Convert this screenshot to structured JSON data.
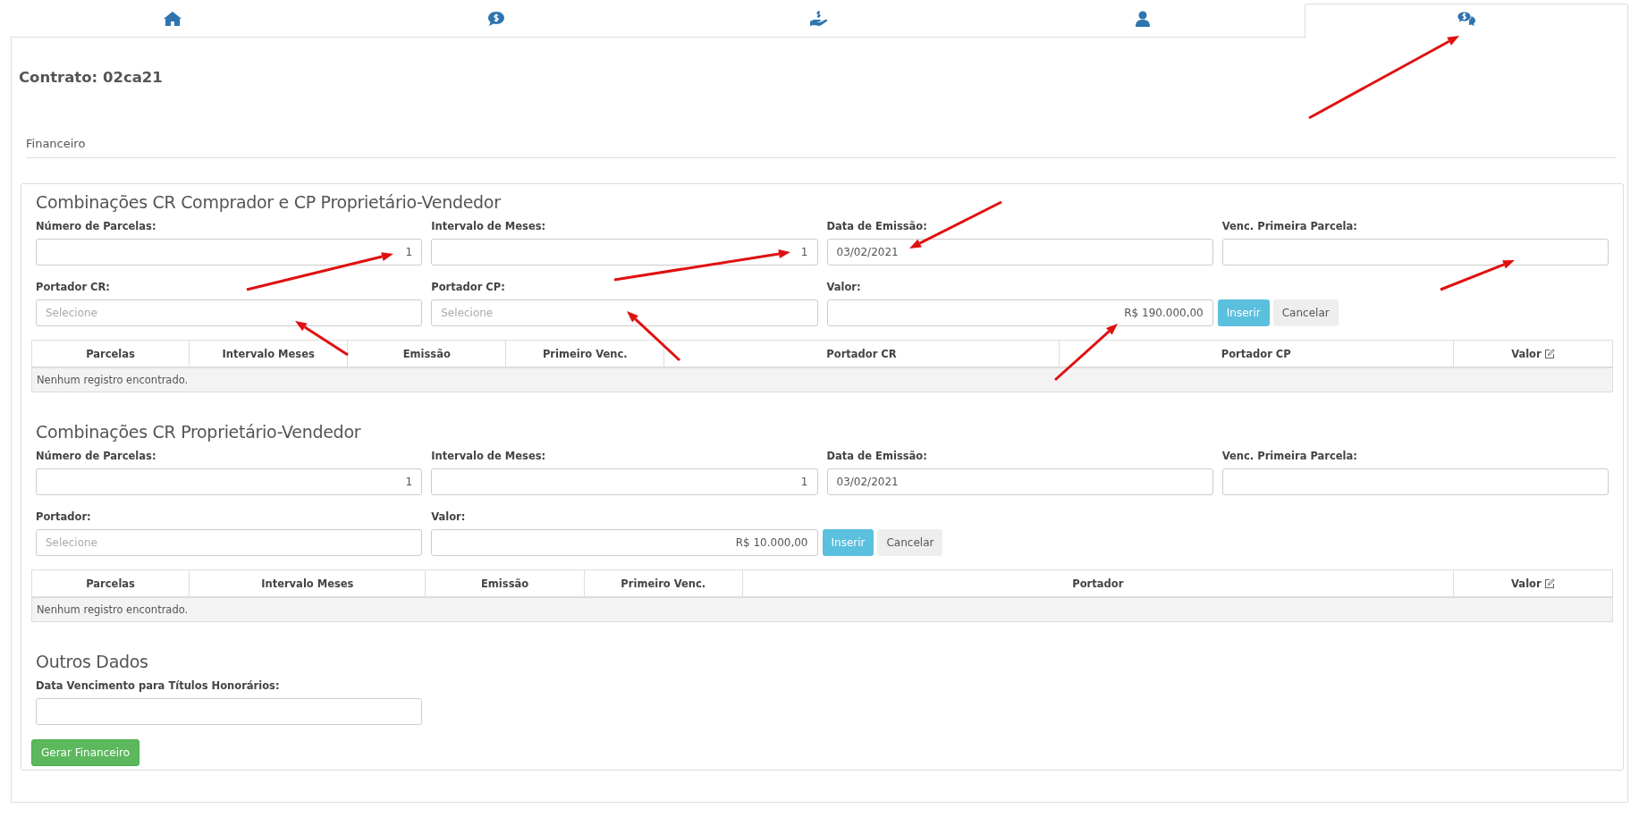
{
  "tabs": [
    {
      "kind": "home",
      "selected": false
    },
    {
      "kind": "money-bubble",
      "selected": false
    },
    {
      "kind": "money-hand",
      "selected": false
    },
    {
      "kind": "user",
      "selected": false
    },
    {
      "kind": "money-chat",
      "selected": true
    }
  ],
  "contract_title": "Contrato: 02ca21",
  "section_label": "Financeiro",
  "sections": [
    {
      "title": "Combinações CR Comprador e CP Proprietário-Vendedor",
      "fields": [
        {
          "kind": "number",
          "label": "Número de Parcelas:",
          "value": "1"
        },
        {
          "kind": "number",
          "label": "Intervalo de Meses:",
          "value": "1"
        },
        {
          "kind": "date",
          "label": "Data de Emissão:",
          "value": "03/02/2021"
        },
        {
          "kind": "date",
          "label": "Venc. Primeira Parcela:"
        },
        {
          "kind": "select",
          "label": "Portador CR:",
          "placeholder": "Selecione"
        },
        {
          "kind": "select",
          "label": "Portador CP:",
          "placeholder": "Selecione"
        },
        {
          "kind": "money",
          "label": "Valor:",
          "value": "R$ 190.000,00"
        }
      ],
      "buttons": [
        {
          "kind": "primary",
          "label": "Inserir"
        },
        {
          "kind": "default",
          "label": "Cancelar"
        }
      ],
      "table": {
        "columns": [
          {
            "label": "Parcelas",
            "editable": false
          },
          {
            "label": "Intervalo Meses",
            "editable": false
          },
          {
            "label": "Emissão",
            "editable": false
          },
          {
            "label": "Primeiro Venc.",
            "editable": false
          },
          {
            "label": "Portador CR",
            "editable": false
          },
          {
            "label": "Portador CP",
            "editable": false
          },
          {
            "label": "Valor",
            "editable": true
          }
        ],
        "empty_message": "Nenhum registro encontrado."
      }
    },
    {
      "title": "Combinações CR Proprietário-Vendedor",
      "fields": [
        {
          "kind": "number",
          "label": "Número de Parcelas:",
          "value": "1"
        },
        {
          "kind": "number",
          "label": "Intervalo de Meses:",
          "value": "1"
        },
        {
          "kind": "date",
          "label": "Data de Emissão:",
          "value": "03/02/2021"
        },
        {
          "kind": "date",
          "label": "Venc. Primeira Parcela:"
        },
        {
          "kind": "select",
          "label": "Portador:",
          "placeholder": "Selecione"
        },
        {
          "kind": "money",
          "label": "Valor:",
          "value": "R$ 10.000,00"
        }
      ],
      "buttons": [
        {
          "kind": "primary",
          "label": "Inserir"
        },
        {
          "kind": "default",
          "label": "Cancelar"
        }
      ],
      "table": {
        "columns": [
          {
            "label": "Parcelas",
            "editable": false
          },
          {
            "label": "Intervalo Meses",
            "editable": false
          },
          {
            "label": "Emissão",
            "editable": false
          },
          {
            "label": "Primeiro Venc.",
            "editable": false
          },
          {
            "label": "Portador",
            "editable": false
          },
          {
            "label": "Valor",
            "editable": true
          }
        ],
        "empty_message": "Nenhum registro encontrado."
      }
    },
    {
      "title": "Outros Dados",
      "fields": [
        {
          "kind": "date",
          "label": "Data Vencimento para Títulos Honorários:"
        }
      ],
      "buttons": [
        {
          "kind": "success",
          "label": "Gerar Financeiro"
        }
      ]
    }
  ]
}
